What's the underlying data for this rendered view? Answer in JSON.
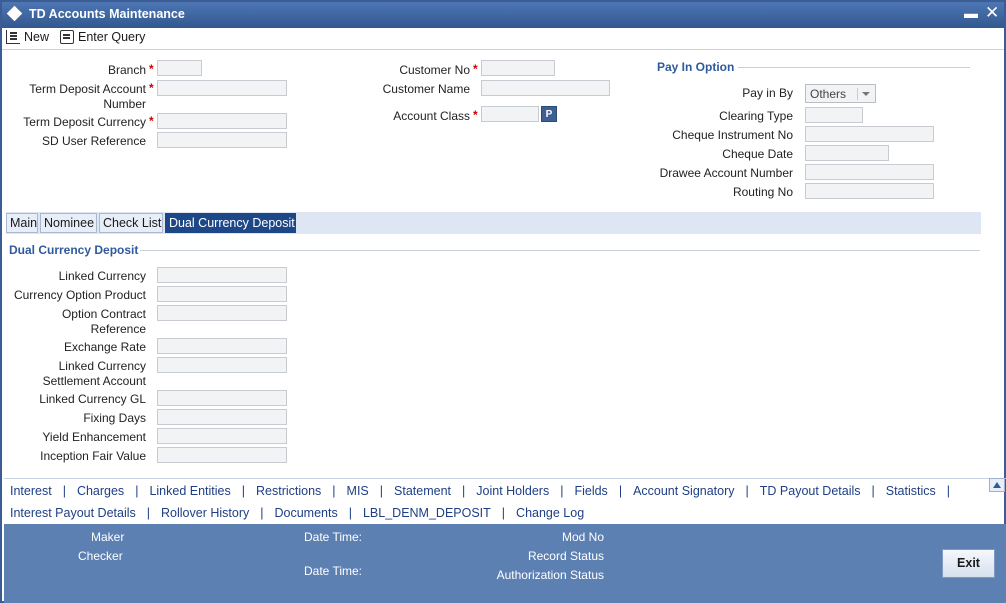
{
  "window": {
    "title": "TD Accounts Maintenance"
  },
  "toolbar": {
    "new_label": "New",
    "enter_query_label": "Enter Query"
  },
  "header": {
    "branch_label": "Branch",
    "term_deposit_account_label_line1": "Term Deposit Account",
    "term_deposit_account_label_line2": "Number",
    "term_deposit_currency_label": "Term Deposit Currency",
    "sd_user_reference_label": "SD User Reference",
    "customer_no_label": "Customer No",
    "customer_name_label": "Customer Name",
    "account_class_label": "Account Class",
    "account_class_lov": "P",
    "required_marker": "*"
  },
  "pay_in": {
    "section_title": "Pay In Option",
    "pay_in_by_label": "Pay in By",
    "pay_in_by_value": "Others",
    "clearing_type_label": "Clearing Type",
    "cheque_instrument_no_label": "Cheque Instrument No",
    "cheque_date_label": "Cheque Date",
    "drawee_account_number_label": "Drawee Account Number",
    "routing_no_label": "Routing No"
  },
  "tabs": [
    {
      "label": "Main"
    },
    {
      "label": "Nominee"
    },
    {
      "label": "Check List"
    },
    {
      "label": "Dual Currency Deposit"
    }
  ],
  "dual_currency": {
    "section_title": "Dual Currency Deposit",
    "linked_currency_label": "Linked Currency",
    "currency_option_product_label": "Currency Option Product",
    "option_contract_reference_line1": "Option Contract",
    "option_contract_reference_line2": "Reference",
    "exchange_rate_label": "Exchange Rate",
    "linked_currency_settlement_line1": "Linked Currency",
    "linked_currency_settlement_line2": "Settlement Account",
    "linked_currency_gl_label": "Linked Currency GL",
    "fixing_days_label": "Fixing Days",
    "yield_enhancement_label": "Yield Enhancement",
    "inception_fair_value_label": "Inception Fair Value"
  },
  "links": {
    "row1": [
      "Interest",
      "Charges",
      "Linked Entities",
      "Restrictions",
      "MIS",
      "Statement",
      "Joint Holders",
      "Fields",
      "Account Signatory",
      "TD Payout Details",
      "Statistics"
    ],
    "row2": [
      "Interest Payout Details",
      "Rollover History",
      "Documents",
      "LBL_DENM_DEPOSIT",
      "Change Log"
    ],
    "separator": "|"
  },
  "footer": {
    "maker_label": "Maker",
    "checker_label": "Checker",
    "date_time_label_1": "Date Time:",
    "date_time_label_2": "Date Time:",
    "mod_no_label": "Mod No",
    "record_status_label": "Record Status",
    "authorization_status_label": "Authorization Status",
    "exit_label": "Exit"
  },
  "colors": {
    "title_bar": "#3b5d93",
    "active_tab": "#1e4788",
    "section_title": "#2f5a9b",
    "footer": "#5d80b2",
    "required": "#cc0000"
  }
}
